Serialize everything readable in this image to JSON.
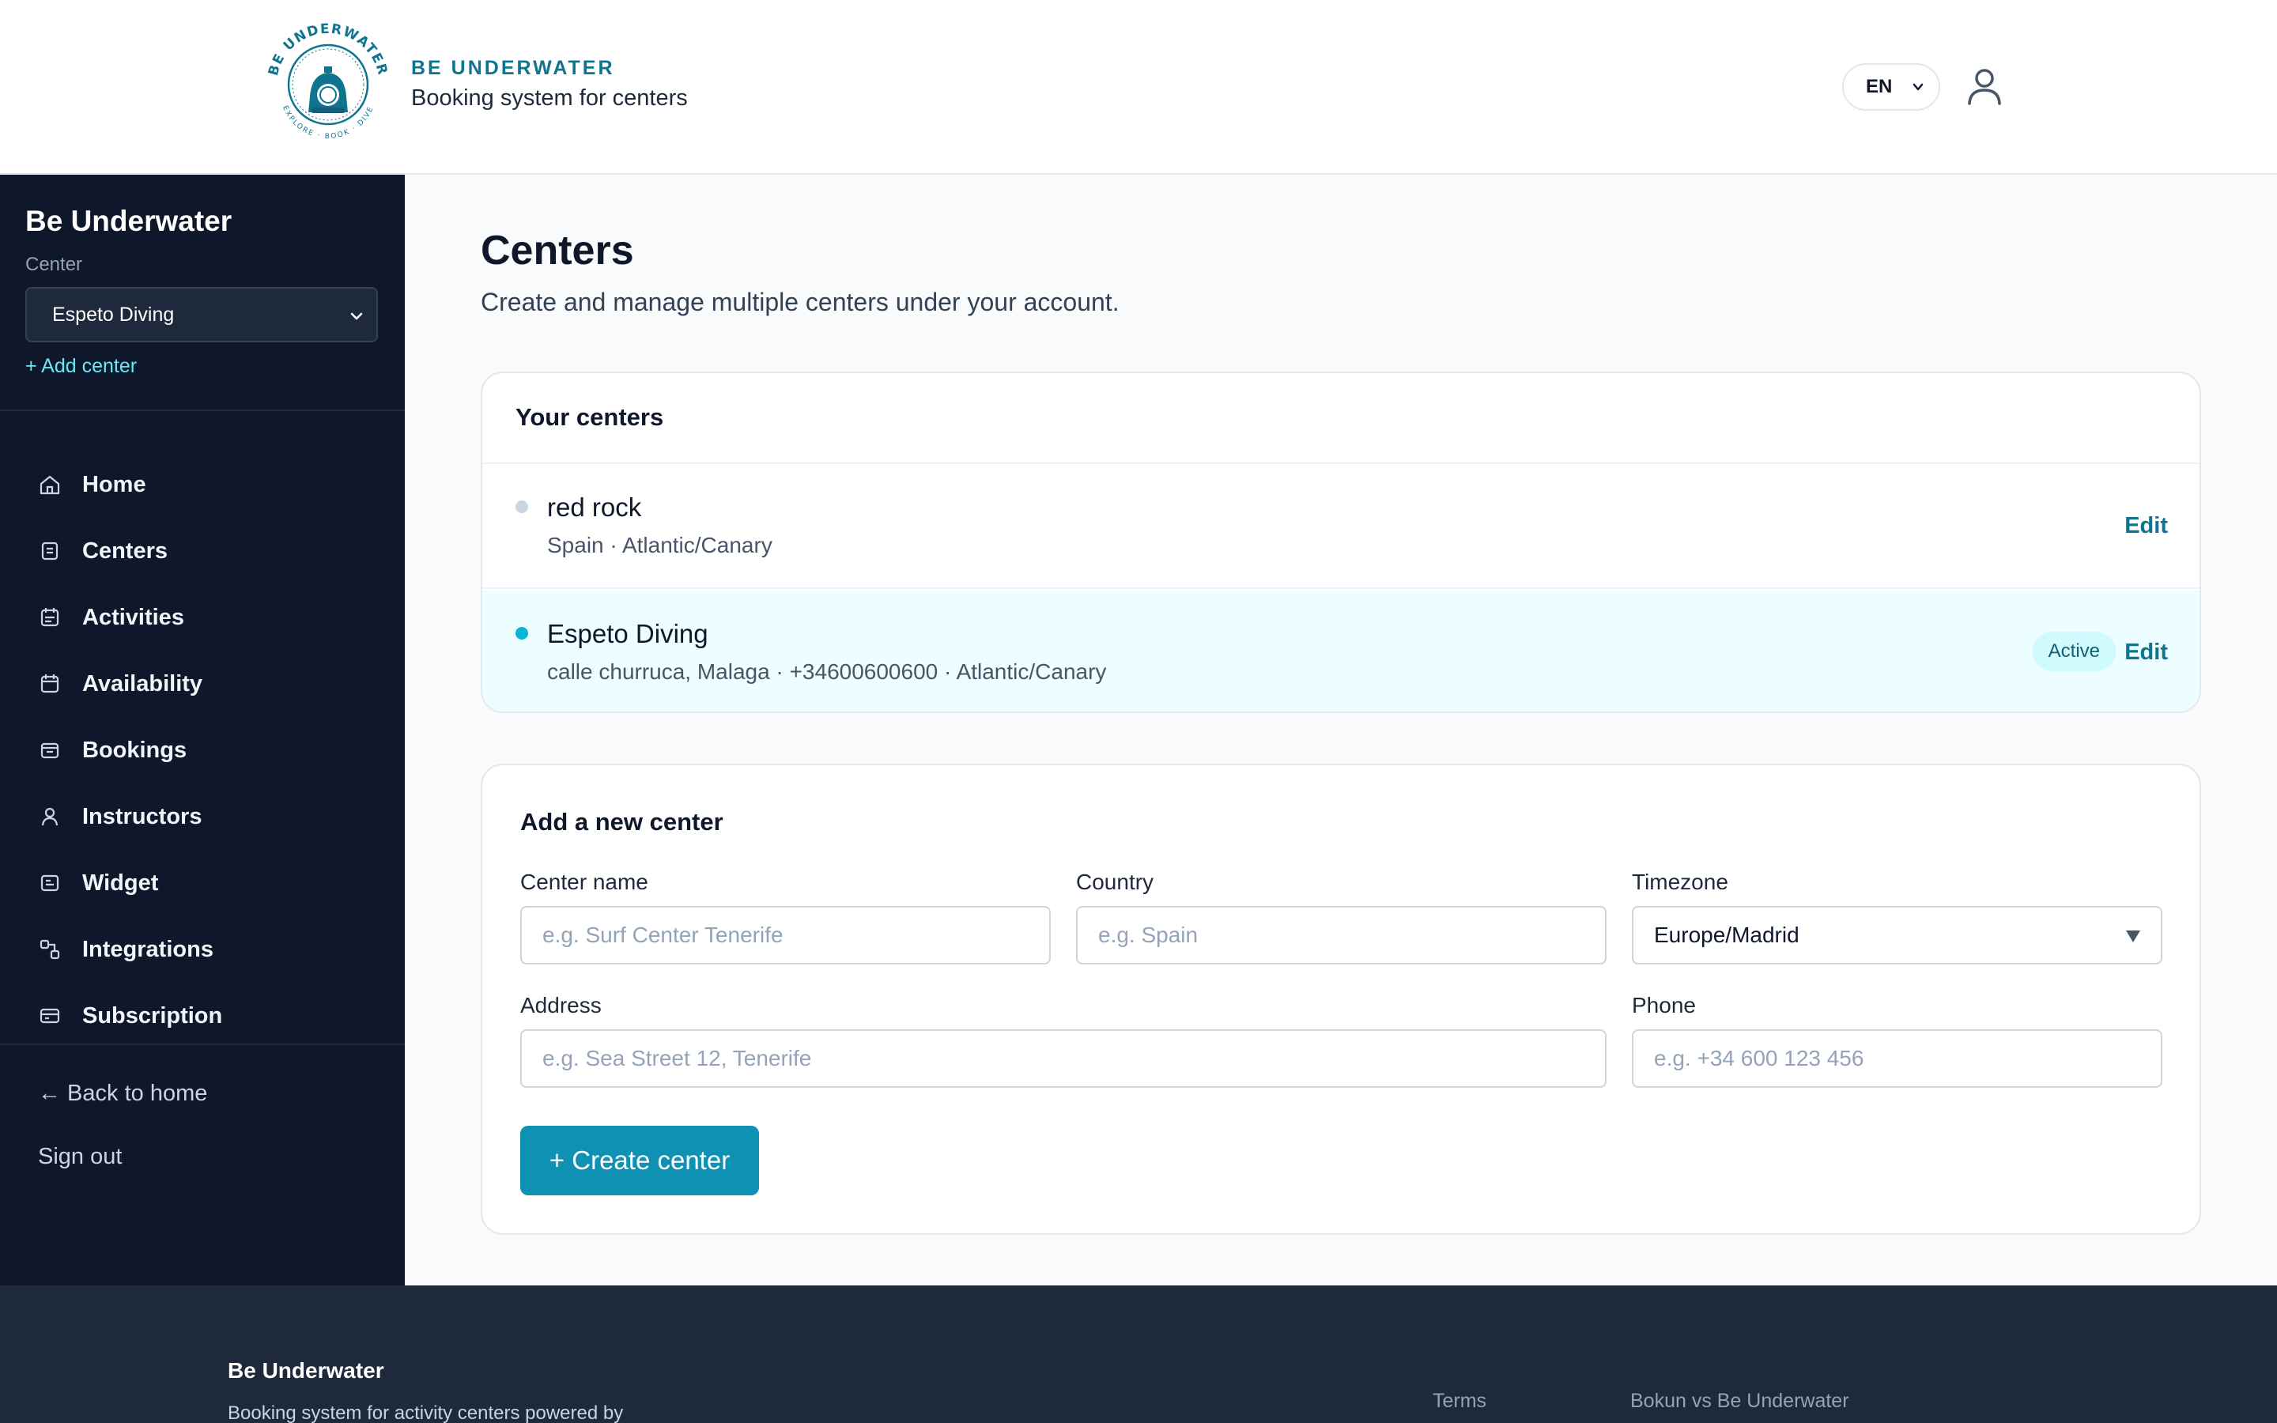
{
  "header": {
    "brand_name": "BE UNDERWATER",
    "brand_subtitle": "Booking system for centers",
    "logo_ring_top": "BE UNDERWATER",
    "logo_ring_bottom": "EXPLORE · BOOK · DIVE",
    "language": "EN"
  },
  "sidebar": {
    "title": "Be Underwater",
    "center_label": "Center",
    "selected_center": "Espeto Diving",
    "add_center": "+ Add center",
    "items": [
      {
        "label": "Home",
        "icon": "home-icon"
      },
      {
        "label": "Centers",
        "icon": "centers-icon"
      },
      {
        "label": "Activities",
        "icon": "activities-icon"
      },
      {
        "label": "Availability",
        "icon": "calendar-icon"
      },
      {
        "label": "Bookings",
        "icon": "bookings-icon"
      },
      {
        "label": "Instructors",
        "icon": "person-icon"
      },
      {
        "label": "Widget",
        "icon": "widget-icon"
      },
      {
        "label": "Integrations",
        "icon": "integrations-icon"
      },
      {
        "label": "Subscription",
        "icon": "card-icon"
      }
    ],
    "back_home": "← Back to home",
    "sign_out": "Sign out"
  },
  "main": {
    "title": "Centers",
    "subtitle": "Create and manage multiple centers under your account.",
    "centers_card": {
      "heading": "Your centers",
      "centers": [
        {
          "name": "red rock",
          "meta": "Spain · Atlantic/Canary",
          "active": false,
          "edit": "Edit"
        },
        {
          "name": "Espeto Diving",
          "meta": "calle churruca, Malaga · +34600600600 · Atlantic/Canary",
          "active": true,
          "badge": "Active",
          "edit": "Edit"
        }
      ]
    },
    "new_center": {
      "heading": "Add a new center",
      "name_label": "Center name",
      "name_placeholder": "e.g. Surf Center Tenerife",
      "country_label": "Country",
      "country_placeholder": "e.g. Spain",
      "timezone_label": "Timezone",
      "timezone_value": "Europe/Madrid",
      "address_label": "Address",
      "address_placeholder": "e.g. Sea Street 12, Tenerife",
      "phone_label": "Phone",
      "phone_placeholder": "e.g. +34 600 123 456",
      "create_button": "+ Create center"
    }
  },
  "footer": {
    "title": "Be Underwater",
    "description": "Booking system for activity centers powered by",
    "links": [
      "Terms",
      "Bokun vs Be Underwater"
    ]
  },
  "colors": {
    "accent": "#0e91b2",
    "accent_dark": "#0e7490",
    "sidebar_bg": "#0f172a",
    "footer_bg": "#1e293b",
    "active_row": "#ecfeff",
    "active_dot": "#06b6d4",
    "inactive_dot": "#cbd5e1"
  }
}
